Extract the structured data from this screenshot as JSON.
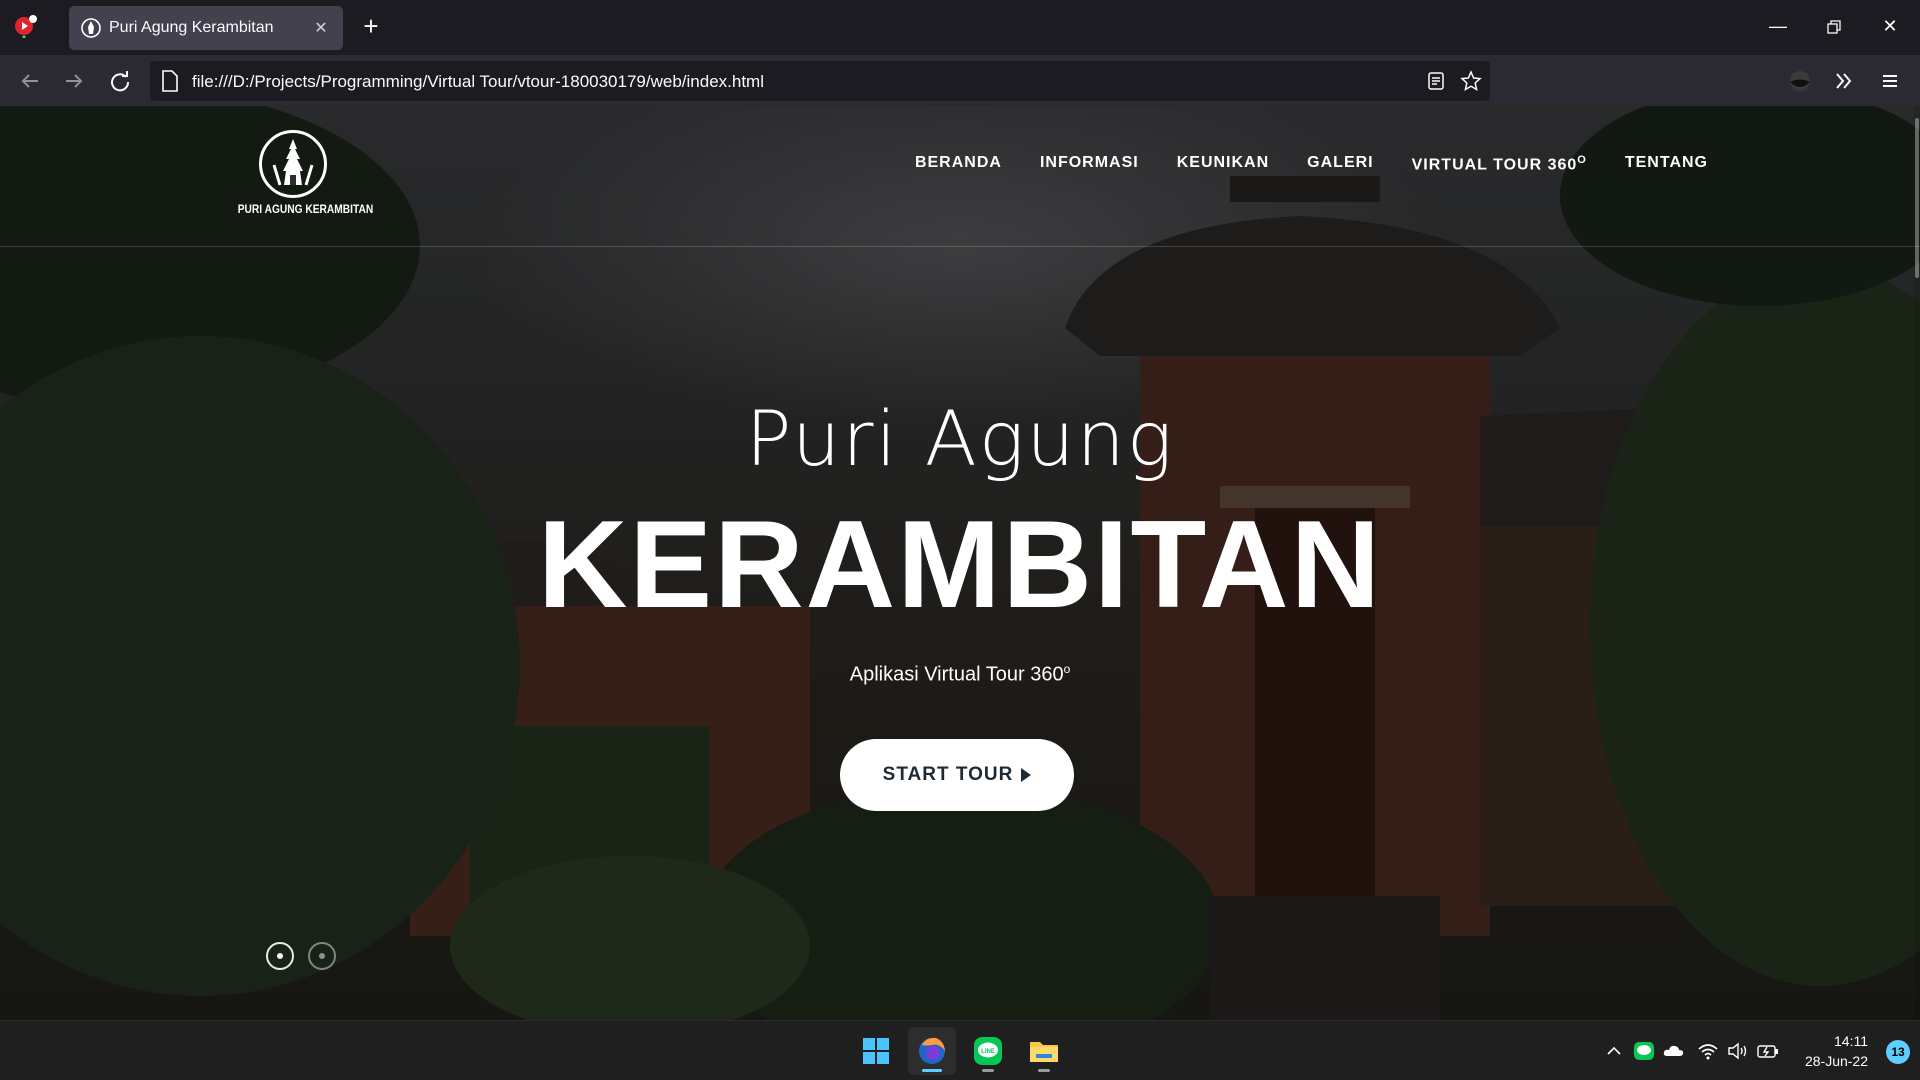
{
  "browser": {
    "tab_title": "Puri Agung Kerambitan",
    "new_tab_icon": "plus-icon",
    "url": "file:///D:/Projects/Programming/Virtual Tour/vtour-180030179/web/index.html"
  },
  "site": {
    "logo_text": "PURI AGUNG KERAMBITAN",
    "menu": [
      "BERANDA",
      "INFORMASI",
      "KEUNIKAN",
      "GALERI",
      "VIRTUAL TOUR 360",
      "TENTANG"
    ],
    "menu_superscript": "O",
    "hero_subtitle": "Puri Agung",
    "hero_title": "KERAMBITAN",
    "hero_tagline": "Aplikasi Virtual Tour 360",
    "tagline_superscript": "o",
    "start_button": "START TOUR",
    "slides_total": 2,
    "slide_active": 1
  },
  "taskbar": {
    "time": "14:11",
    "date": "28-Jun-22",
    "notification_count": "13",
    "apps": [
      "windows-start-icon",
      "firefox-icon",
      "line-icon",
      "file-explorer-icon"
    ]
  },
  "colors": {
    "accent": "#60cdff",
    "button_text": "#1e2a33"
  }
}
